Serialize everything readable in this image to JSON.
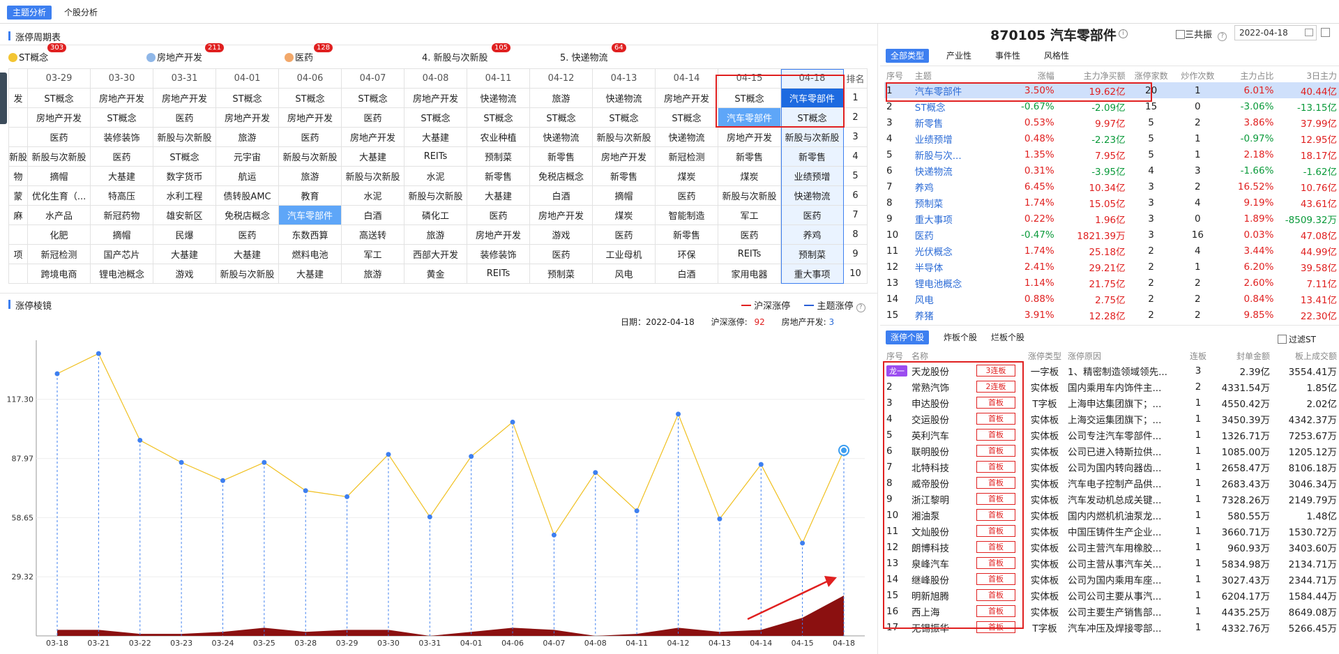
{
  "tabs": [
    "主题分析",
    "个股分析"
  ],
  "cycle_title": "涨停周期表",
  "top_themes": [
    {
      "name": "ST概念",
      "count": "303",
      "dot": "#f3c533"
    },
    {
      "name": "房地产开发",
      "count": "211",
      "dot": "#8fb7e8"
    },
    {
      "name": "医药",
      "count": "128",
      "dot": "#f2a86a"
    },
    {
      "name": "4. 新股与次新股",
      "count": "105",
      "dot": ""
    },
    {
      "name": "5. 快递物流",
      "count": "64",
      "dot": ""
    }
  ],
  "grid_dates": [
    "",
    "03-29",
    "03-30",
    "03-31",
    "04-01",
    "04-06",
    "04-07",
    "04-08",
    "04-11",
    "04-12",
    "04-13",
    "04-14",
    "04-15",
    "04-18",
    "排名"
  ],
  "grid_rows": [
    [
      "发",
      "ST概念",
      "房地产开发",
      "房地产开发",
      "ST概念",
      "ST概念",
      "ST概念",
      "房地产开发",
      "快递物流",
      "旅游",
      "快递物流",
      "房地产开发",
      "ST概念",
      "汽车零部件",
      "1"
    ],
    [
      "",
      "房地产开发",
      "ST概念",
      "医药",
      "房地产开发",
      "房地产开发",
      "医药",
      "ST概念",
      "ST概念",
      "ST概念",
      "ST概念",
      "ST概念",
      "汽车零部件",
      "ST概念",
      "2"
    ],
    [
      "",
      "医药",
      "装修装饰",
      "新股与次新股",
      "旅游",
      "医药",
      "房地产开发",
      "大基建",
      "农业种植",
      "快递物流",
      "新股与次新股",
      "快递物流",
      "房地产开发",
      "新股与次新股",
      "3"
    ],
    [
      "新股",
      "新股与次新股",
      "医药",
      "ST概念",
      "元宇宙",
      "新股与次新股",
      "大基建",
      "REITs",
      "预制菜",
      "新零售",
      "房地产开发",
      "新冠检测",
      "新零售",
      "新零售",
      "4"
    ],
    [
      "物",
      "摘帽",
      "大基建",
      "数字货币",
      "航运",
      "旅游",
      "新股与次新股",
      "水泥",
      "新零售",
      "免税店概念",
      "新零售",
      "煤炭",
      "煤炭",
      "业绩预增",
      "5"
    ],
    [
      "蒙",
      "优化生育（...",
      "特高压",
      "水利工程",
      "债转股AMC",
      "教育",
      "水泥",
      "新股与次新股",
      "大基建",
      "白酒",
      "摘帽",
      "医药",
      "新股与次新股",
      "快递物流",
      "6"
    ],
    [
      "麻",
      "水产品",
      "新冠药物",
      "雄安新区",
      "免税店概念",
      "汽车零部件",
      "白酒",
      "磷化工",
      "医药",
      "房地产开发",
      "煤炭",
      "智能制造",
      "军工",
      "医药",
      "7"
    ],
    [
      "",
      "化肥",
      "摘帽",
      "民爆",
      "医药",
      "东数西算",
      "高送转",
      "旅游",
      "房地产开发",
      "游戏",
      "医药",
      "新零售",
      "医药",
      "养鸡",
      "8"
    ],
    [
      "项",
      "新冠检测",
      "国产芯片",
      "大基建",
      "大基建",
      "燃料电池",
      "军工",
      "西部大开发",
      "装修装饰",
      "医药",
      "工业母机",
      "环保",
      "REITs",
      "预制菜",
      "9"
    ],
    [
      "",
      "跨境电商",
      "锂电池概念",
      "游戏",
      "新股与次新股",
      "大基建",
      "旅游",
      "黄金",
      "REITs",
      "预制菜",
      "风电",
      "白酒",
      "家用电器",
      "重大事项",
      "10"
    ]
  ],
  "lens": {
    "title": "涨停棱镜",
    "legend_a": "沪深涨停",
    "legend_b": "主题涨停",
    "date_label": "日期：2022-04-18",
    "hs_label": "沪深涨停:",
    "hs_value": "92",
    "theme_label": "房地产开发:",
    "theme_value": "3"
  },
  "chart_data": {
    "type": "line",
    "x": [
      "03-18",
      "03-21",
      "03-22",
      "03-23",
      "03-24",
      "03-25",
      "03-28",
      "03-29",
      "03-30",
      "03-31",
      "04-01",
      "04-06",
      "04-07",
      "04-08",
      "04-11",
      "04-12",
      "04-13",
      "04-14",
      "04-15",
      "04-18"
    ],
    "yticks": [
      "117.30",
      "87.97",
      "58.65",
      "29.32"
    ],
    "ylim": [
      0,
      146.6
    ],
    "series": [
      {
        "name": "沪深涨停",
        "color": "#f0c020",
        "values": [
          130,
          140,
          97,
          86,
          77,
          86,
          72,
          69,
          90,
          59,
          89,
          106,
          50,
          81,
          62,
          110,
          58,
          85,
          46,
          92
        ]
      },
      {
        "name": "主题涨停",
        "color": "#8b1010",
        "values": [
          3,
          3,
          1,
          1,
          2,
          4,
          2,
          3,
          3,
          0,
          2,
          4,
          3,
          0,
          1,
          4,
          2,
          3,
          9,
          20
        ]
      }
    ]
  },
  "right": {
    "title": "870105 汽车零部件",
    "sanban": "三共振",
    "date": "2022-04-18",
    "type_tabs": [
      "全部类型",
      "产业性",
      "事件性",
      "风格性"
    ],
    "ind_headers": [
      "序号",
      "主题",
      "涨幅",
      "主力净买额",
      "涨停家数",
      "炒作次数",
      "主力占比",
      "3日主力"
    ],
    "industries": [
      [
        "1",
        "汽车零部件",
        "3.50%",
        "19.62亿",
        "20",
        "1",
        "6.01%",
        "40.44亿"
      ],
      [
        "2",
        "ST概念",
        "-0.67%",
        "-2.09亿",
        "15",
        "0",
        "-3.06%",
        "-13.15亿"
      ],
      [
        "3",
        "新零售",
        "0.53%",
        "9.97亿",
        "5",
        "2",
        "3.86%",
        "37.99亿"
      ],
      [
        "4",
        "业绩预增",
        "0.48%",
        "-2.23亿",
        "5",
        "1",
        "-0.97%",
        "12.95亿"
      ],
      [
        "5",
        "新股与次...",
        "1.35%",
        "7.95亿",
        "5",
        "1",
        "2.18%",
        "18.17亿"
      ],
      [
        "6",
        "快递物流",
        "0.31%",
        "-3.95亿",
        "4",
        "3",
        "-1.66%",
        "-1.62亿"
      ],
      [
        "7",
        "养鸡",
        "6.45%",
        "10.34亿",
        "3",
        "2",
        "16.52%",
        "10.76亿"
      ],
      [
        "8",
        "预制菜",
        "1.74%",
        "15.05亿",
        "3",
        "4",
        "9.19%",
        "43.61亿"
      ],
      [
        "9",
        "重大事项",
        "0.22%",
        "1.96亿",
        "3",
        "0",
        "1.89%",
        "-8509.32万"
      ],
      [
        "10",
        "医药",
        "-0.47%",
        "1821.39万",
        "3",
        "16",
        "0.03%",
        "47.08亿"
      ],
      [
        "11",
        "光伏概念",
        "1.74%",
        "25.18亿",
        "2",
        "4",
        "3.44%",
        "44.99亿"
      ],
      [
        "12",
        "半导体",
        "2.41%",
        "29.21亿",
        "2",
        "1",
        "6.20%",
        "39.58亿"
      ],
      [
        "13",
        "锂电池概念",
        "1.14%",
        "21.75亿",
        "2",
        "2",
        "2.60%",
        "7.11亿"
      ],
      [
        "14",
        "风电",
        "0.88%",
        "2.75亿",
        "2",
        "2",
        "0.84%",
        "13.41亿"
      ],
      [
        "15",
        "养猪",
        "3.91%",
        "12.28亿",
        "2",
        "2",
        "9.85%",
        "22.30亿"
      ]
    ],
    "stock_tabs": [
      "涨停个股",
      "炸板个股",
      "烂板个股"
    ],
    "filter_st": "过滤ST",
    "stk_headers": [
      "序号",
      "名称",
      "",
      "涨停类型",
      "涨停原因",
      "连板",
      "封单金额",
      "板上成交额"
    ],
    "stocks": [
      [
        "龙一",
        "天龙股份",
        "3连板",
        "一字板",
        "1、精密制造领域领先...",
        "3",
        "2.39亿",
        "3554.41万"
      ],
      [
        "2",
        "常熟汽饰",
        "2连板",
        "实体板",
        "国内乘用车内饰件主...",
        "2",
        "4331.54万",
        "1.85亿"
      ],
      [
        "3",
        "申达股份",
        "首板",
        "T字板",
        "上海申达集团旗下；...",
        "1",
        "4550.42万",
        "2.02亿"
      ],
      [
        "4",
        "交运股份",
        "首板",
        "实体板",
        "上海交运集团旗下；...",
        "1",
        "3450.39万",
        "4342.37万"
      ],
      [
        "5",
        "英利汽车",
        "首板",
        "实体板",
        "公司专注汽车零部件...",
        "1",
        "1326.71万",
        "7253.67万"
      ],
      [
        "6",
        "联明股份",
        "首板",
        "实体板",
        "公司已进入特斯拉供...",
        "1",
        "1085.00万",
        "1205.12万"
      ],
      [
        "7",
        "北特科技",
        "首板",
        "实体板",
        "公司为国内转向器齿...",
        "1",
        "2658.47万",
        "8106.18万"
      ],
      [
        "8",
        "威帝股份",
        "首板",
        "实体板",
        "汽车电子控制产品供...",
        "1",
        "2683.43万",
        "3046.34万"
      ],
      [
        "9",
        "浙江黎明",
        "首板",
        "实体板",
        "汽车发动机总成关键...",
        "1",
        "7328.26万",
        "2149.79万"
      ],
      [
        "10",
        "湘油泵",
        "首板",
        "实体板",
        "国内内燃机机油泵龙...",
        "1",
        "580.55万",
        "1.48亿"
      ],
      [
        "11",
        "文灿股份",
        "首板",
        "实体板",
        "中国压铸件生产企业...",
        "1",
        "3660.71万",
        "1530.72万"
      ],
      [
        "12",
        "朗博科技",
        "首板",
        "实体板",
        "公司主营汽车用橡胶...",
        "1",
        "960.93万",
        "3403.60万"
      ],
      [
        "13",
        "泉峰汽车",
        "首板",
        "实体板",
        "公司主营从事汽车关...",
        "1",
        "5834.98万",
        "2134.71万"
      ],
      [
        "14",
        "继峰股份",
        "首板",
        "实体板",
        "公司为国内乘用车座...",
        "1",
        "3027.43万",
        "2344.71万"
      ],
      [
        "15",
        "明新旭腾",
        "首板",
        "实体板",
        "公司公司主要从事汽...",
        "1",
        "6204.17万",
        "1584.44万"
      ],
      [
        "16",
        "西上海",
        "首板",
        "实体板",
        "公司主要生产销售部...",
        "1",
        "4435.25万",
        "8649.08万"
      ],
      [
        "17",
        "无锡振华",
        "首板",
        "T字板",
        "汽车冲压及焊接零部...",
        "1",
        "4332.76万",
        "5266.45万"
      ]
    ]
  }
}
